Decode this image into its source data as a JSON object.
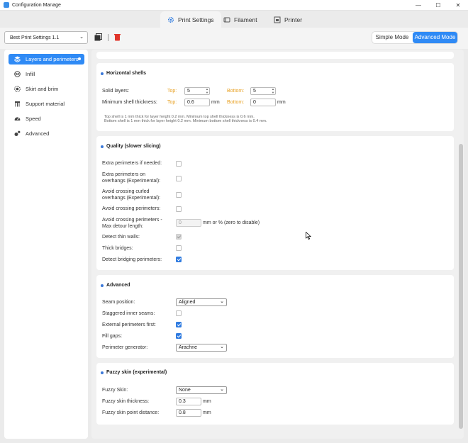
{
  "window": {
    "title": "Configuration Manage",
    "minimize": "—",
    "maximize": "☐",
    "close": "✕"
  },
  "tabs": [
    {
      "label": "Print Settings",
      "icon": "gear-icon"
    },
    {
      "label": "Filament",
      "icon": "filament-icon"
    },
    {
      "label": "Printer",
      "icon": "printer-icon"
    }
  ],
  "toolbar": {
    "preset": "Best Print Settings 1.1",
    "simple_mode": "Simple Mode",
    "advanced_mode": "Advanced Mode"
  },
  "sidebar": {
    "items": [
      {
        "label": "Layers and perimeters",
        "icon": "layers-icon"
      },
      {
        "label": "Infill",
        "icon": "infill-icon"
      },
      {
        "label": "Skirt and brim",
        "icon": "skirt-icon"
      },
      {
        "label": "Support material",
        "icon": "support-icon"
      },
      {
        "label": "Speed",
        "icon": "speed-icon"
      },
      {
        "label": "Advanced",
        "icon": "advanced-icon"
      }
    ]
  },
  "horizontal_shells": {
    "title": "Horizontal shells",
    "solid_layers_label": "Solid layers:",
    "top_label": "Top:",
    "top_value": "5",
    "bottom_label": "Bottom:",
    "bottom_value": "5",
    "min_thickness_label": "Minimum shell thickness:",
    "min_top_label": "Top:",
    "min_top_value": "0.6",
    "unit": "mm",
    "min_bottom_label": "Bottom:",
    "min_bottom_value": "0",
    "note1": "Top shell is 1 mm thick for layer height 0.2 mm. Minimum top shell thickness is 0.6 mm.",
    "note2": "Bottom shell is 1 mm thick for layer height 0.2 mm. Minimum bottom shell thickness is 0.4 mm."
  },
  "quality": {
    "title": "Quality (slower slicing)",
    "extra_perim": "Extra perimeters if needed:",
    "extra_overhangs": "Extra perimeters on overhangs (Experimental):",
    "avoid_curled": "Avoid crossing curled overhangs (Experimental):",
    "avoid_crossing": "Avoid crossing perimeters:",
    "avoid_detour": "Avoid crossing perimeters - Max detour length:",
    "detour_value": "0",
    "detour_unit": "mm or % (zero to disable)",
    "thin_walls": "Detect thin walls:",
    "thick_bridges": "Thick bridges:",
    "bridging": "Detect bridging perimeters:"
  },
  "advanced": {
    "title": "Advanced",
    "seam_label": "Seam position:",
    "seam_value": "Aligned",
    "staggered": "Staggered inner seams:",
    "external_first": "External perimeters first:",
    "fill_gaps": "Fill gaps:",
    "generator_label": "Perimeter generator:",
    "generator_value": "Arachne"
  },
  "fuzzy": {
    "title": "Fuzzy skin (experimental)",
    "skin_label": "Fuzzy Skin:",
    "skin_value": "None",
    "thickness_label": "Fuzzy skin thickness:",
    "thickness_value": "0.3",
    "distance_label": "Fuzzy skin point distance:",
    "distance_value": "0.8",
    "unit": "mm"
  },
  "colors": {
    "accent": "#2f8af5",
    "orange": "#e8a020"
  }
}
